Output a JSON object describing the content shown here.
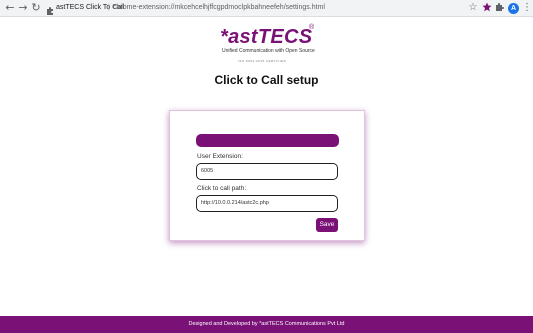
{
  "browser": {
    "back_icon": "back-arrow-icon",
    "forward_icon": "forward-arrow-icon",
    "reload_icon": "reload-icon",
    "site_label": "astTECS Click To Call",
    "separator": "|",
    "url": "chrome-extension://mkcehcelhjffcgpdmoclpkbahneefeh/settings.html",
    "avatar_letter": "A"
  },
  "logo": {
    "name": "*astTECS",
    "registered": "®",
    "tagline": "Unified Communication with Open Source",
    "certification": "ISO 9001:2015  CERTIFIED"
  },
  "page": {
    "title": "Click to Call setup"
  },
  "form": {
    "extension_label": "User Extension:",
    "extension_value": "6005",
    "path_label": "Click to call path:",
    "path_value": "http://10.0.0.214/astc2c.php",
    "save_label": "Save"
  },
  "footer": {
    "text": "Designed and Developed by *astTECS Communications Pvt Ltd"
  },
  "colors": {
    "brand": "#7a1176"
  }
}
